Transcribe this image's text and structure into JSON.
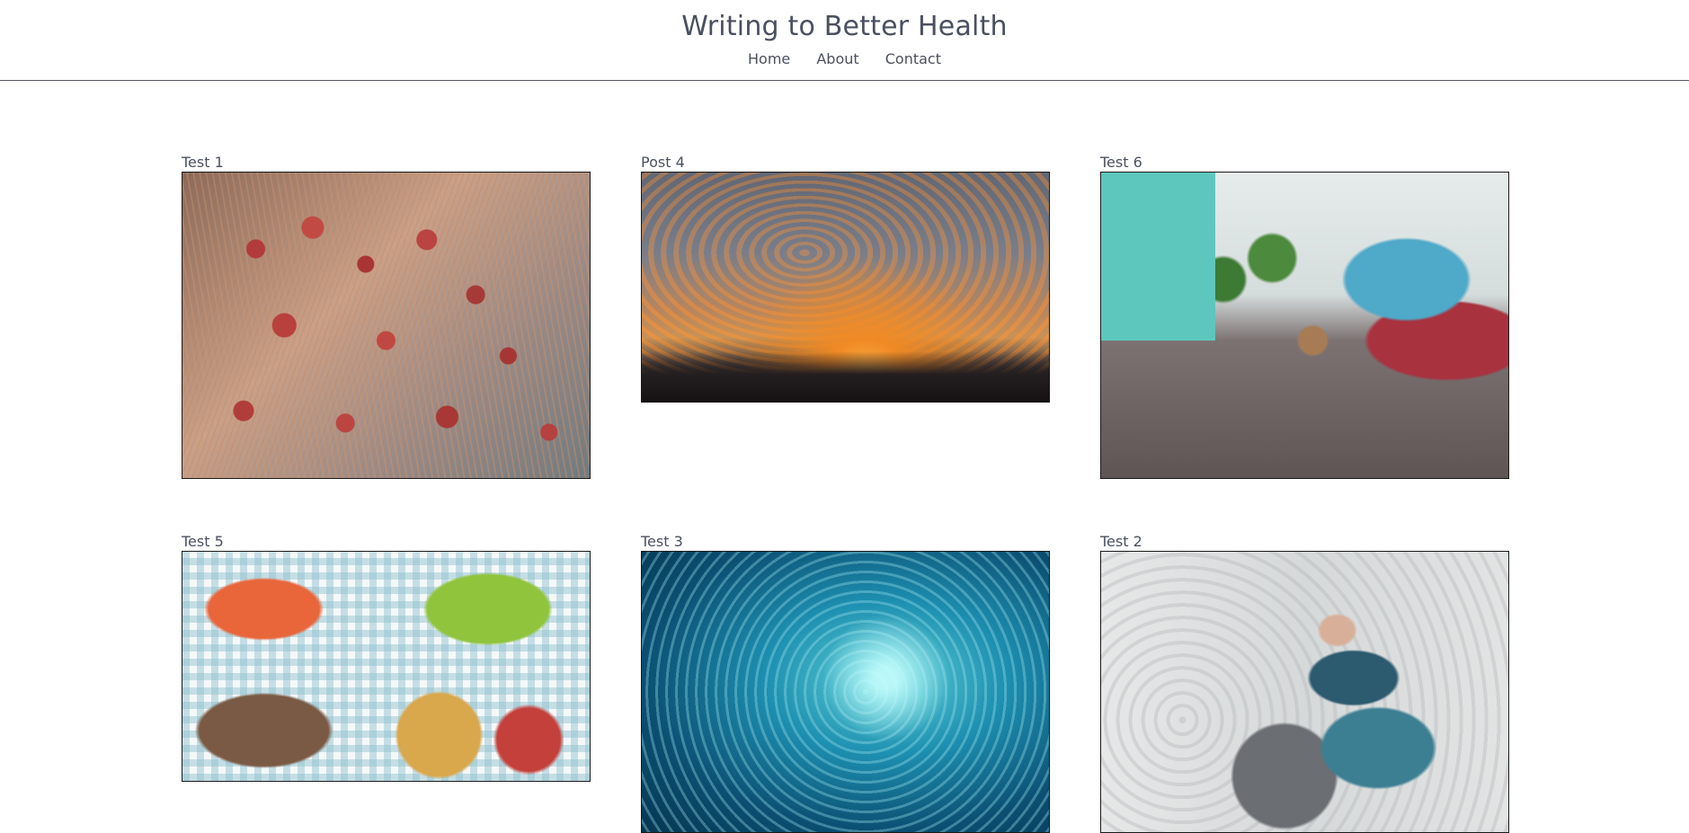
{
  "site": {
    "title": "Writing to Better Health"
  },
  "nav": {
    "items": [
      {
        "label": "Home"
      },
      {
        "label": "About"
      },
      {
        "label": "Contact"
      }
    ]
  },
  "posts": [
    {
      "title": "Test 1"
    },
    {
      "title": "Post 4"
    },
    {
      "title": "Test 6"
    },
    {
      "title": "Test 5"
    },
    {
      "title": "Test 3"
    },
    {
      "title": "Test 2"
    }
  ]
}
